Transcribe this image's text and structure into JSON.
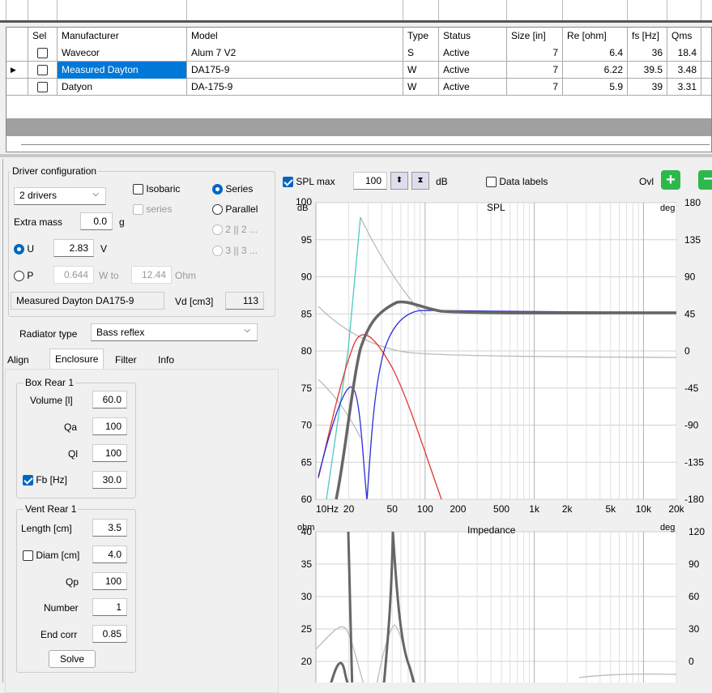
{
  "table": {
    "headers": {
      "sel": "Sel",
      "manufacturer": "Manufacturer",
      "model": "Model",
      "type": "Type",
      "status": "Status",
      "size": "Size [in]",
      "re": "Re [ohm]",
      "fs": "fs [Hz]",
      "qms": "Qms"
    },
    "rows": [
      {
        "manufacturer": "Wavecor",
        "model": "Alum 7 V2",
        "type": "S",
        "status": "Active",
        "size": "7",
        "re": "6.4",
        "fs": "36",
        "qms": "18.4"
      },
      {
        "manufacturer": "Measured Dayton",
        "model": "DA175-9",
        "type": "W",
        "status": "Active",
        "size": "7",
        "re": "6.22",
        "fs": "39.5",
        "qms": "3.48"
      },
      {
        "manufacturer": "Datyon",
        "model": "DA-175-9",
        "type": "W",
        "status": "Active",
        "size": "7",
        "re": "5.9",
        "fs": "39",
        "qms": "3.31"
      }
    ]
  },
  "driver_config": {
    "title": "Driver configuration",
    "drivers": "2 drivers",
    "isobaric": "Isobaric",
    "series_small": "series",
    "series": "Series",
    "parallel": "Parallel",
    "opt_2": "2 || 2 ...",
    "opt_3": "3 || 3 ...",
    "extra_mass_label": "Extra mass",
    "extra_mass": "0.0",
    "extra_mass_unit": "g",
    "u_label": "U",
    "u_value": "2.83",
    "u_unit": "V",
    "p_label": "P",
    "p_value": "0.644",
    "p_unit": "W to",
    "ohm_value": "12.44",
    "ohm_unit": "Ohm",
    "driver_name": "Measured Dayton DA175-9",
    "vd_label": "Vd [cm3]",
    "vd_value": "113"
  },
  "radiator": {
    "label": "Radiator type",
    "value": "Bass reflex"
  },
  "tabs": [
    "Align",
    "Enclosure",
    "Filter",
    "Info"
  ],
  "box": {
    "title": "Box Rear 1",
    "volume_label": "Volume [l]",
    "volume": "60.0",
    "qa_label": "Qa",
    "qa": "100",
    "ql_label": "Ql",
    "ql": "100",
    "fb_label": "Fb [Hz]",
    "fb": "30.0"
  },
  "vent": {
    "title": "Vent Rear 1",
    "length_label": "Length [cm]",
    "length": "3.5",
    "diam_label": "Diam [cm]",
    "diam": "4.0",
    "qp_label": "Qp",
    "qp": "100",
    "number_label": "Number",
    "number": "1",
    "endcorr_label": "End corr",
    "endcorr": "0.85",
    "solve": "Solve"
  },
  "toolbar": {
    "splmax_label": "SPL max",
    "splmax": "100",
    "db": "dB",
    "data_labels": "Data labels",
    "ovl": "Ovl"
  },
  "spl_chart": {
    "title": "SPL",
    "y_unit": "dB",
    "y2_unit": "deg",
    "y_ticks": [
      "100",
      "95",
      "90",
      "85",
      "80",
      "75",
      "70",
      "65",
      "60"
    ],
    "y2_ticks": [
      "180",
      "135",
      "90",
      "45",
      "0",
      "-45",
      "-90",
      "-135",
      "-180"
    ],
    "x_ticks": [
      "10Hz",
      "20",
      "50",
      "100",
      "200",
      "500",
      "1k",
      "2k",
      "5k",
      "10k",
      "20k"
    ]
  },
  "imp_chart": {
    "title": "Impedance",
    "y_unit": "ohm",
    "y2_unit": "deg",
    "y_ticks": [
      "40",
      "35",
      "30",
      "25",
      "20"
    ],
    "y2_ticks": [
      "120",
      "90",
      "60",
      "30",
      "0"
    ]
  },
  "colors": {
    "accent": "#0067c0",
    "selection": "#0078d7",
    "plus": "#2db84c"
  }
}
